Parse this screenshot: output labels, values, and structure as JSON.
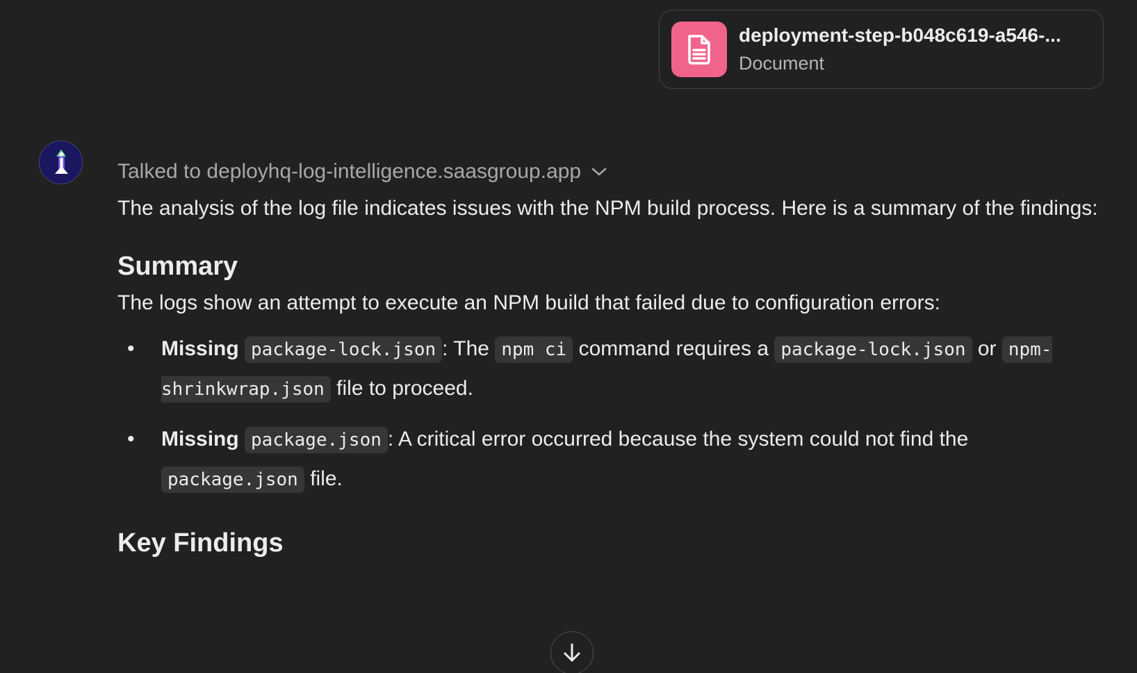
{
  "attachment": {
    "name": "deployment-step-b048c619-a546-...",
    "type": "Document",
    "icon": "document-icon",
    "color": "#f0648c"
  },
  "avatar": {
    "icon": "gpt-avatar-icon"
  },
  "message": {
    "tool_call": "Talked to deployhq-log-intelligence.saasgroup.app",
    "intro": "The analysis of the log file indicates issues with the NPM build process. Here is a summary of the findings:",
    "summary_heading": "Summary",
    "summary_intro": "The logs show an attempt to execute an NPM build that failed due to configuration errors:",
    "bullets": [
      {
        "label": "Missing",
        "code1": "package-lock.json",
        "text1": ": The",
        "code2": "npm ci",
        "text2": "command requires a",
        "code3": "package-lock.json",
        "text3": "or",
        "code4": "npm-shrinkwrap.json",
        "text4": "file to proceed."
      },
      {
        "label": "Missing",
        "code1": "package.json",
        "text1": ": A critical error occurred because the system could not find the",
        "code2": "package.json",
        "text2": "file."
      }
    ],
    "key_findings_heading": "Key Findings"
  },
  "scroll_button": {
    "icon": "arrow-down-icon"
  }
}
